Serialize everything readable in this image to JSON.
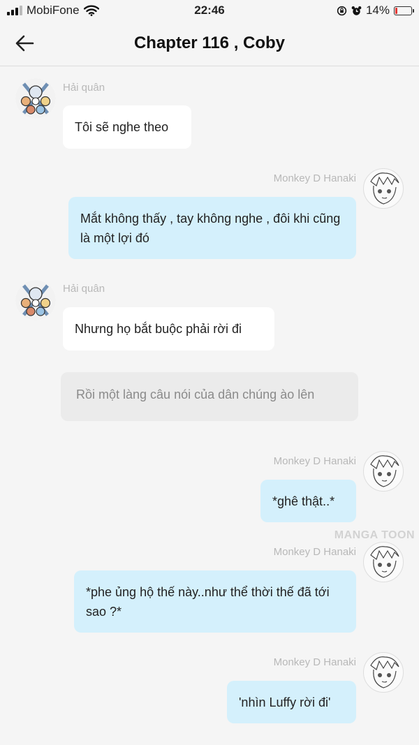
{
  "status_bar": {
    "carrier": "MobiFone",
    "time": "22:46",
    "battery_percent": "14%",
    "battery_level": 0.14,
    "battery_color": "#e53935"
  },
  "header": {
    "title": "Chapter 116 , Coby",
    "back_icon": "arrow-left-icon"
  },
  "messages": [
    {
      "sender": "Hải quân",
      "side": "left",
      "text": "Tôi sẽ nghe theo"
    },
    {
      "sender": "Monkey D Hanaki",
      "side": "right",
      "text": "Mắt không thấy , tay không nghe , đôi khi cũng là một lợi đó"
    },
    {
      "sender": "Hải quân",
      "side": "left",
      "text": "Nhưng họ bắt buộc phải rời đi"
    },
    {
      "sender": "",
      "side": "narration",
      "text": "Rồi một làng câu nói của dân chúng ào lên"
    },
    {
      "sender": "Monkey D Hanaki",
      "side": "right",
      "text": "*ghê thật..*"
    },
    {
      "sender": "Monkey D Hanaki",
      "side": "right",
      "text": "*phe ủng hộ thế này..như thể thời thế đã tới sao ?*"
    },
    {
      "sender": "Monkey D Hanaki",
      "side": "right",
      "text": "'nhìn Luffy rời đi'"
    }
  ],
  "watermark": "MANGA TOON",
  "colors": {
    "background": "#f5f5f5",
    "blue_bubble": "#d4f0fc",
    "white_bubble": "#ffffff",
    "narration_bubble": "#ebebeb"
  }
}
